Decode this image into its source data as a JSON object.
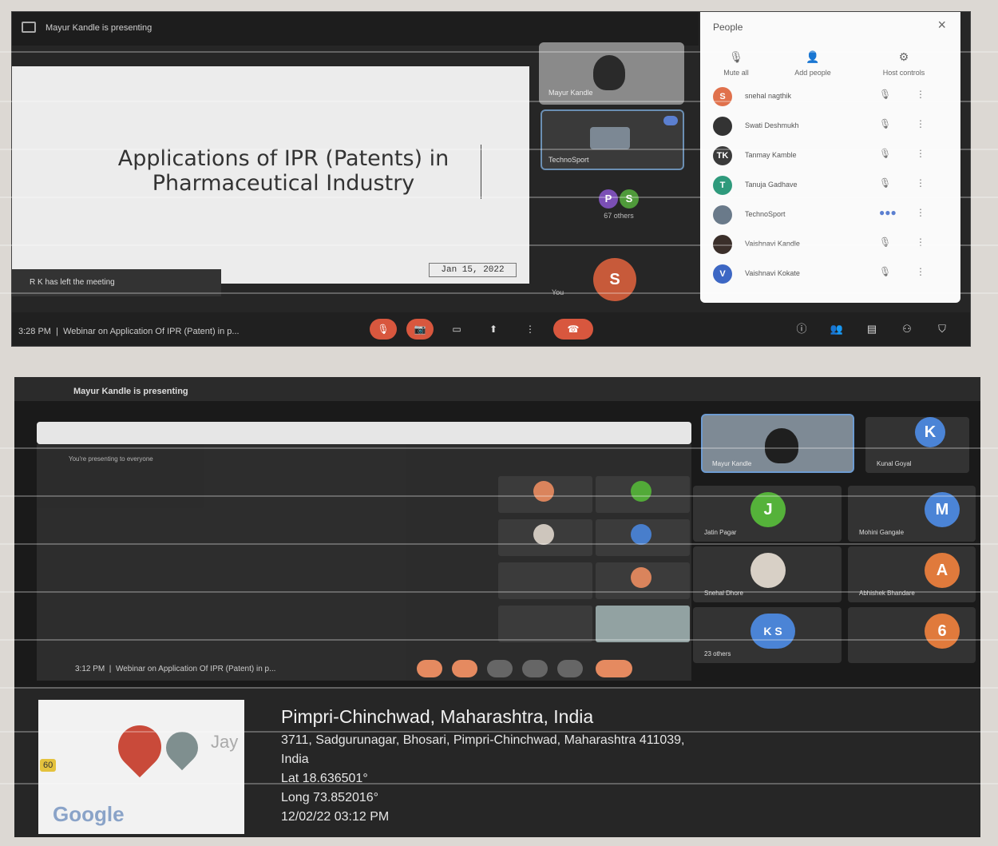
{
  "top": {
    "presenting_text": "Mayur Kandle is presenting",
    "slide_title_line1": "Applications of IPR (Patents) in",
    "slide_title_line2": "Pharmaceutical Industry",
    "slide_date": "Jan 15, 2022",
    "toast": "R K has left the meeting",
    "tile_main_name": "Mayur Kandle",
    "tile_second_name": "TechnoSport",
    "others_label": "67 others",
    "others_avatars": [
      "P",
      "S"
    ],
    "you_initial": "S",
    "you_label": "You",
    "clock": "3:28 PM",
    "meeting_title": "Webinar on Application Of IPR (Patent) in p...",
    "people_panel": {
      "title": "People",
      "close": "×",
      "actions": [
        {
          "label": "Mute all",
          "icon": "mic-off-icon"
        },
        {
          "label": "Add people",
          "icon": "add-person-icon"
        },
        {
          "label": "Host controls",
          "icon": "host-controls-icon"
        }
      ],
      "participants": [
        {
          "name": "snehal nagthik",
          "initial": "S",
          "color": "#e0714c"
        },
        {
          "name": "Swati Deshmukh",
          "initial": "",
          "color": "#333333"
        },
        {
          "name": "Tanmay Kamble",
          "initial": "TK",
          "color": "#3a3a3a"
        },
        {
          "name": "Tanuja Gadhave",
          "initial": "T",
          "color": "#2f9a7c"
        },
        {
          "name": "TechnoSport",
          "initial": "",
          "color": "#6a7a8a"
        },
        {
          "name": "Vaishnavi Kandle",
          "initial": "",
          "color": "#3b2f2a"
        },
        {
          "name": "Vaishnavi Kokate",
          "initial": "V",
          "color": "#3d67c4"
        }
      ]
    }
  },
  "bottom": {
    "presenting_text": "Mayur Kandle is presenting",
    "inner_presenting": "You're presenting to everyone",
    "tile_main_name": "Mayur Kandle",
    "participants": [
      {
        "initial": "K",
        "name": "Kunal Goyal",
        "color": "#4b84d6"
      },
      {
        "initial": "J",
        "name": "Jatin Pagar",
        "color": "#55b23a"
      },
      {
        "initial": "M",
        "name": "Mohini Gangale",
        "color": "#4b84d6"
      },
      {
        "initial": "",
        "name": "Snehal Dhore",
        "color": "#d8d0c6"
      },
      {
        "initial": "A",
        "name": "Abhishek Bhandare",
        "color": "#e07a3c"
      },
      {
        "initial": "K S",
        "name": "23 others",
        "color": "#4b84d6"
      },
      {
        "initial": "6",
        "name": "",
        "color": "#e07a3c"
      }
    ],
    "clock": "3:12 PM",
    "meeting_title": "Webinar on Application Of IPR (Patent) in p...",
    "geo": {
      "map_label": "Jay",
      "badge": "60",
      "google": "Google",
      "title": "Pimpri-Chinchwad, Maharashtra, India",
      "address1": "3711, Sadgurunagar, Bhosari, Pimpri-Chinchwad, Maharashtra 411039,",
      "address2": "India",
      "lat": "Lat 18.636501°",
      "long": "Long 73.852016°",
      "datetime": "12/02/22 03:12 PM"
    }
  }
}
